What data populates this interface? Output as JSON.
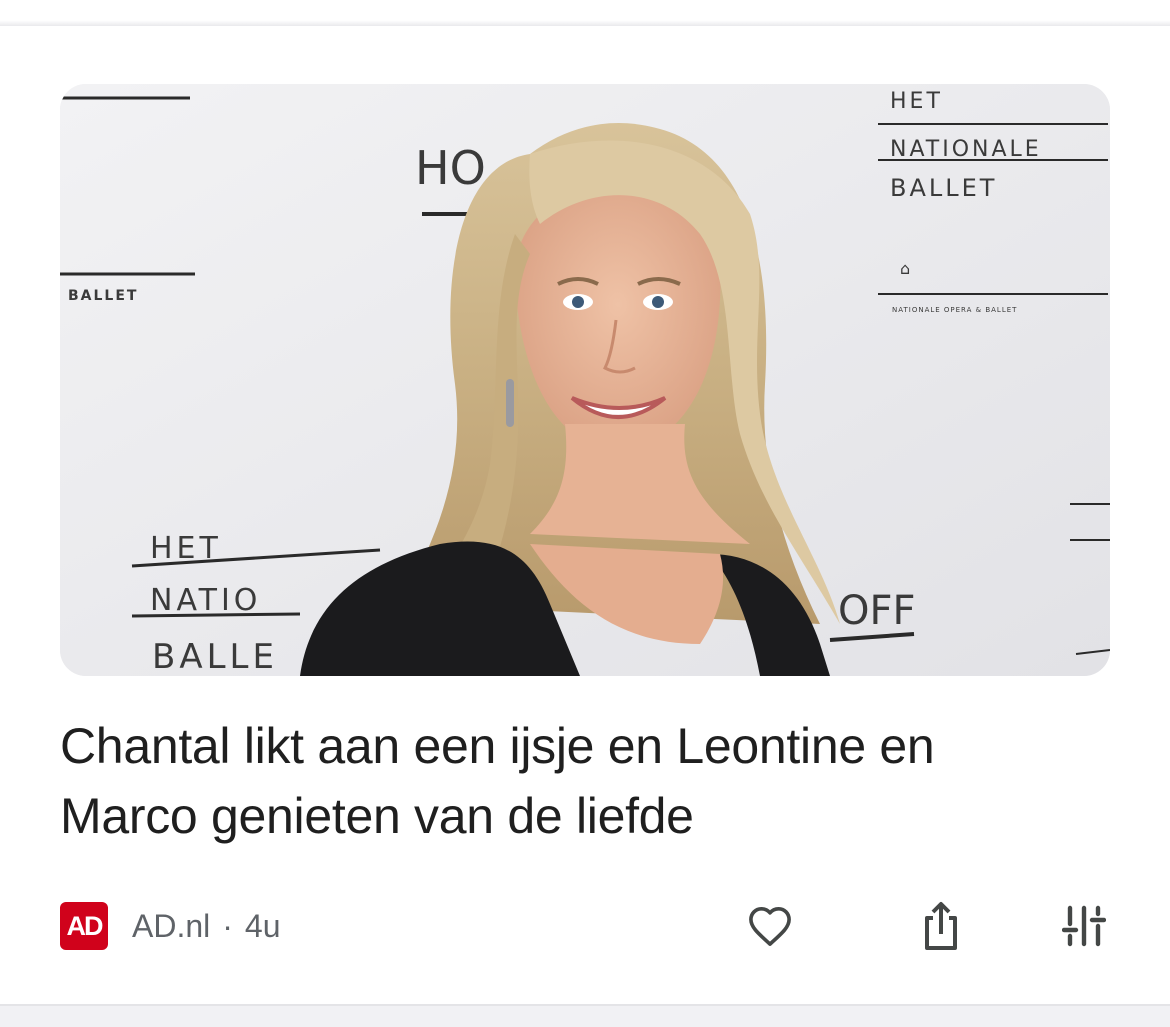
{
  "article": {
    "headline": "Chantal likt aan een ijsje en Leontine en Marco genieten van de liefde",
    "source": {
      "logo_text": "AD",
      "logo_color": "#d0021b",
      "name": "AD.nl",
      "separator": "·",
      "age": "4u"
    },
    "image": {
      "backdrop_text": {
        "left_top": "BALLET",
        "left_bottom_line1": "HET",
        "left_bottom_line2": "NATIO",
        "left_bottom_line3": "BALLE",
        "center_top": "HO",
        "center_bottom": "OFF",
        "right_top_line1": "HET",
        "right_top_line2": "NATIONALE",
        "right_top_line3": "BALLET",
        "right_top_small": "NATIONALE OPERA & BALLET"
      }
    }
  },
  "actions": {
    "like_icon": "heart-icon",
    "share_icon": "share-icon",
    "more_icon": "tune-icon"
  },
  "colors": {
    "headline": "#1f1f1f",
    "meta": "#5f6368",
    "icon": "#444746"
  }
}
